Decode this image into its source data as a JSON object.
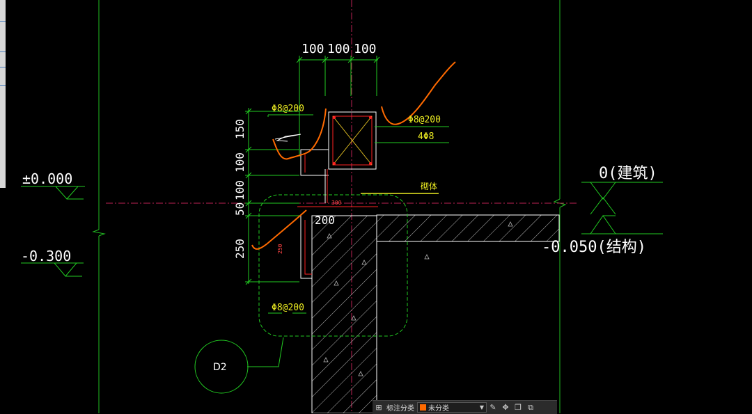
{
  "drawing": {
    "dims_top": [
      "100",
      "100",
      "100"
    ],
    "dims_left": [
      "150",
      "100",
      "100",
      "50",
      "250"
    ],
    "rebar_1": "Φ8@200",
    "rebar_2": "Φ8@200",
    "rebar_3": "4Φ8",
    "rebar_4": "Φ8@200",
    "masonry": "砌体",
    "dim_300": "300",
    "dim_200": "200",
    "dim_250": "250",
    "elev_left_1": "±0.000",
    "elev_left_2": "-0.300",
    "elev_right_1": "0(建筑)",
    "elev_right_2": "-0.050(结构)",
    "detail_id": "D2"
  },
  "toolbar": {
    "label": "标注分类",
    "select_value": "未分类",
    "swatch_color": "#ff6a00",
    "icons": [
      "grid-icon",
      "edit-icon",
      "move-icon",
      "copy-icon",
      "paste-icon"
    ]
  }
}
